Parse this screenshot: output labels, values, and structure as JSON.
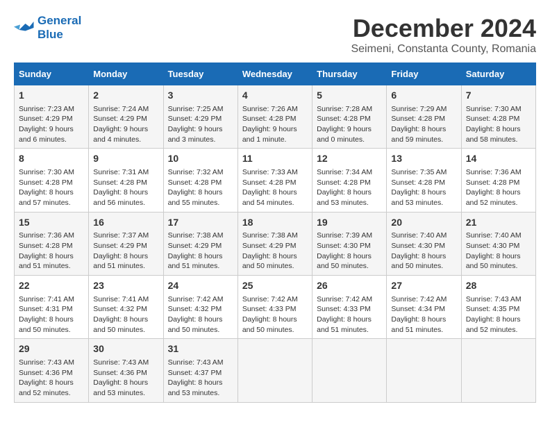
{
  "header": {
    "logo_line1": "General",
    "logo_line2": "Blue",
    "title": "December 2024",
    "subtitle": "Seimeni, Constanta County, Romania"
  },
  "weekdays": [
    "Sunday",
    "Monday",
    "Tuesday",
    "Wednesday",
    "Thursday",
    "Friday",
    "Saturday"
  ],
  "weeks": [
    [
      {
        "day": "1",
        "detail": "Sunrise: 7:23 AM\nSunset: 4:29 PM\nDaylight: 9 hours and 6 minutes."
      },
      {
        "day": "2",
        "detail": "Sunrise: 7:24 AM\nSunset: 4:29 PM\nDaylight: 9 hours and 4 minutes."
      },
      {
        "day": "3",
        "detail": "Sunrise: 7:25 AM\nSunset: 4:29 PM\nDaylight: 9 hours and 3 minutes."
      },
      {
        "day": "4",
        "detail": "Sunrise: 7:26 AM\nSunset: 4:28 PM\nDaylight: 9 hours and 1 minute."
      },
      {
        "day": "5",
        "detail": "Sunrise: 7:28 AM\nSunset: 4:28 PM\nDaylight: 9 hours and 0 minutes."
      },
      {
        "day": "6",
        "detail": "Sunrise: 7:29 AM\nSunset: 4:28 PM\nDaylight: 8 hours and 59 minutes."
      },
      {
        "day": "7",
        "detail": "Sunrise: 7:30 AM\nSunset: 4:28 PM\nDaylight: 8 hours and 58 minutes."
      }
    ],
    [
      {
        "day": "8",
        "detail": "Sunrise: 7:30 AM\nSunset: 4:28 PM\nDaylight: 8 hours and 57 minutes."
      },
      {
        "day": "9",
        "detail": "Sunrise: 7:31 AM\nSunset: 4:28 PM\nDaylight: 8 hours and 56 minutes."
      },
      {
        "day": "10",
        "detail": "Sunrise: 7:32 AM\nSunset: 4:28 PM\nDaylight: 8 hours and 55 minutes."
      },
      {
        "day": "11",
        "detail": "Sunrise: 7:33 AM\nSunset: 4:28 PM\nDaylight: 8 hours and 54 minutes."
      },
      {
        "day": "12",
        "detail": "Sunrise: 7:34 AM\nSunset: 4:28 PM\nDaylight: 8 hours and 53 minutes."
      },
      {
        "day": "13",
        "detail": "Sunrise: 7:35 AM\nSunset: 4:28 PM\nDaylight: 8 hours and 53 minutes."
      },
      {
        "day": "14",
        "detail": "Sunrise: 7:36 AM\nSunset: 4:28 PM\nDaylight: 8 hours and 52 minutes."
      }
    ],
    [
      {
        "day": "15",
        "detail": "Sunrise: 7:36 AM\nSunset: 4:28 PM\nDaylight: 8 hours and 51 minutes."
      },
      {
        "day": "16",
        "detail": "Sunrise: 7:37 AM\nSunset: 4:29 PM\nDaylight: 8 hours and 51 minutes."
      },
      {
        "day": "17",
        "detail": "Sunrise: 7:38 AM\nSunset: 4:29 PM\nDaylight: 8 hours and 51 minutes."
      },
      {
        "day": "18",
        "detail": "Sunrise: 7:38 AM\nSunset: 4:29 PM\nDaylight: 8 hours and 50 minutes."
      },
      {
        "day": "19",
        "detail": "Sunrise: 7:39 AM\nSunset: 4:30 PM\nDaylight: 8 hours and 50 minutes."
      },
      {
        "day": "20",
        "detail": "Sunrise: 7:40 AM\nSunset: 4:30 PM\nDaylight: 8 hours and 50 minutes."
      },
      {
        "day": "21",
        "detail": "Sunrise: 7:40 AM\nSunset: 4:30 PM\nDaylight: 8 hours and 50 minutes."
      }
    ],
    [
      {
        "day": "22",
        "detail": "Sunrise: 7:41 AM\nSunset: 4:31 PM\nDaylight: 8 hours and 50 minutes."
      },
      {
        "day": "23",
        "detail": "Sunrise: 7:41 AM\nSunset: 4:32 PM\nDaylight: 8 hours and 50 minutes."
      },
      {
        "day": "24",
        "detail": "Sunrise: 7:42 AM\nSunset: 4:32 PM\nDaylight: 8 hours and 50 minutes."
      },
      {
        "day": "25",
        "detail": "Sunrise: 7:42 AM\nSunset: 4:33 PM\nDaylight: 8 hours and 50 minutes."
      },
      {
        "day": "26",
        "detail": "Sunrise: 7:42 AM\nSunset: 4:33 PM\nDaylight: 8 hours and 51 minutes."
      },
      {
        "day": "27",
        "detail": "Sunrise: 7:42 AM\nSunset: 4:34 PM\nDaylight: 8 hours and 51 minutes."
      },
      {
        "day": "28",
        "detail": "Sunrise: 7:43 AM\nSunset: 4:35 PM\nDaylight: 8 hours and 52 minutes."
      }
    ],
    [
      {
        "day": "29",
        "detail": "Sunrise: 7:43 AM\nSunset: 4:36 PM\nDaylight: 8 hours and 52 minutes."
      },
      {
        "day": "30",
        "detail": "Sunrise: 7:43 AM\nSunset: 4:36 PM\nDaylight: 8 hours and 53 minutes."
      },
      {
        "day": "31",
        "detail": "Sunrise: 7:43 AM\nSunset: 4:37 PM\nDaylight: 8 hours and 53 minutes."
      },
      null,
      null,
      null,
      null
    ]
  ]
}
